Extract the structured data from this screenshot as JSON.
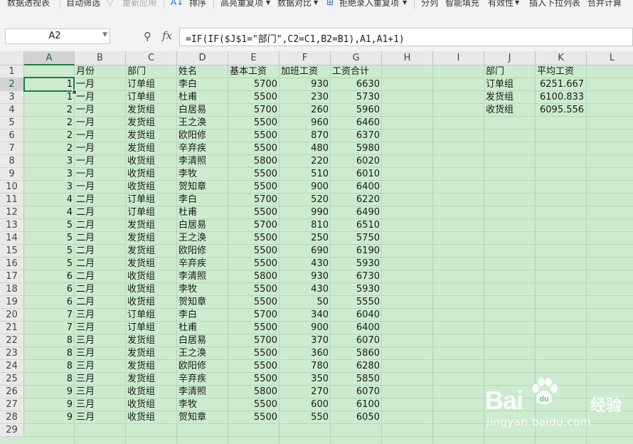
{
  "ribbon": {
    "items": [
      {
        "label": "数据透视表",
        "disabled": false
      },
      {
        "label": "自动筛选",
        "disabled": false
      },
      {
        "label": "重新应用",
        "disabled": true
      },
      {
        "label": "排序",
        "disabled": false
      },
      {
        "label": "高亮重复项",
        "disabled": false
      },
      {
        "label": "数据对比",
        "disabled": false
      },
      {
        "label": "拒绝录入重复项",
        "disabled": false
      },
      {
        "label": "分列",
        "disabled": false
      },
      {
        "label": "智能填充",
        "disabled": false
      },
      {
        "label": "有效性",
        "disabled": false
      },
      {
        "label": "插入下拉列表",
        "disabled": false
      },
      {
        "label": "合并计算",
        "disabled": false
      }
    ]
  },
  "formula_bar": {
    "name_box": "A2",
    "formula": "=IF(IF($J$1=\"部门\",C2=C1,B2=B1),A1,A1+1)"
  },
  "sheet": {
    "columns": [
      "A",
      "B",
      "C",
      "D",
      "E",
      "F",
      "G",
      "H",
      "I",
      "J",
      "K",
      "L"
    ],
    "active_column": "A",
    "active_row": 2,
    "row_numbers": [
      1,
      2,
      3,
      4,
      5,
      6,
      7,
      8,
      9,
      10,
      11,
      12,
      13,
      14,
      15,
      16,
      17,
      18,
      19,
      20,
      21,
      22,
      23,
      24,
      25,
      26,
      27,
      28,
      29
    ],
    "header": [
      "",
      "月份",
      "部门",
      "姓名",
      "基本工资",
      "加班工资",
      "工资合计"
    ],
    "rows": [
      [
        "1",
        "一月",
        "订单组",
        "李白",
        "5700",
        "930",
        "6630"
      ],
      [
        "1",
        "一月",
        "订单组",
        "杜甫",
        "5500",
        "230",
        "5730"
      ],
      [
        "2",
        "一月",
        "发货组",
        "白居易",
        "5700",
        "260",
        "5960"
      ],
      [
        "2",
        "一月",
        "发货组",
        "王之涣",
        "5500",
        "960",
        "6460"
      ],
      [
        "2",
        "一月",
        "发货组",
        "欧阳修",
        "5500",
        "870",
        "6370"
      ],
      [
        "2",
        "一月",
        "发货组",
        "辛弃疾",
        "5500",
        "480",
        "5980"
      ],
      [
        "3",
        "一月",
        "收货组",
        "李清照",
        "5800",
        "220",
        "6020"
      ],
      [
        "3",
        "一月",
        "收货组",
        "李牧",
        "5500",
        "510",
        "6010"
      ],
      [
        "3",
        "一月",
        "收货组",
        "贺知章",
        "5500",
        "900",
        "6400"
      ],
      [
        "4",
        "二月",
        "订单组",
        "李白",
        "5700",
        "520",
        "6220"
      ],
      [
        "4",
        "二月",
        "订单组",
        "杜甫",
        "5500",
        "990",
        "6490"
      ],
      [
        "5",
        "二月",
        "发货组",
        "白居易",
        "5700",
        "810",
        "6510"
      ],
      [
        "5",
        "二月",
        "发货组",
        "王之涣",
        "5500",
        "250",
        "5750"
      ],
      [
        "5",
        "二月",
        "发货组",
        "欧阳修",
        "5500",
        "690",
        "6190"
      ],
      [
        "5",
        "二月",
        "发货组",
        "辛弃疾",
        "5500",
        "430",
        "5930"
      ],
      [
        "6",
        "二月",
        "收货组",
        "李清照",
        "5800",
        "930",
        "6730"
      ],
      [
        "6",
        "二月",
        "收货组",
        "李牧",
        "5500",
        "430",
        "5930"
      ],
      [
        "6",
        "二月",
        "收货组",
        "贺知章",
        "5500",
        "50",
        "5550"
      ],
      [
        "7",
        "三月",
        "订单组",
        "李白",
        "5700",
        "340",
        "6040"
      ],
      [
        "7",
        "三月",
        "订单组",
        "杜甫",
        "5500",
        "900",
        "6400"
      ],
      [
        "8",
        "三月",
        "发货组",
        "白居易",
        "5700",
        "370",
        "6070"
      ],
      [
        "8",
        "三月",
        "发货组",
        "王之涣",
        "5500",
        "360",
        "5860"
      ],
      [
        "8",
        "三月",
        "发货组",
        "欧阳修",
        "5500",
        "780",
        "6280"
      ],
      [
        "8",
        "三月",
        "发货组",
        "辛弃疾",
        "5500",
        "350",
        "5850"
      ],
      [
        "9",
        "三月",
        "收货组",
        "李清照",
        "5800",
        "270",
        "6070"
      ],
      [
        "9",
        "三月",
        "收货组",
        "李牧",
        "5500",
        "600",
        "6100"
      ],
      [
        "9",
        "三月",
        "收货组",
        "贺知章",
        "5500",
        "550",
        "6050"
      ]
    ],
    "summary_header": [
      "部门",
      "平均工资"
    ],
    "summary_rows": [
      [
        "订单组",
        "6251.667"
      ],
      [
        "发货组",
        "6100.833"
      ],
      [
        "收货组",
        "6095.556"
      ]
    ]
  },
  "watermark": {
    "logo": "Bai",
    "logo_tail": "经验",
    "url": "jingyan.baidu.com"
  }
}
